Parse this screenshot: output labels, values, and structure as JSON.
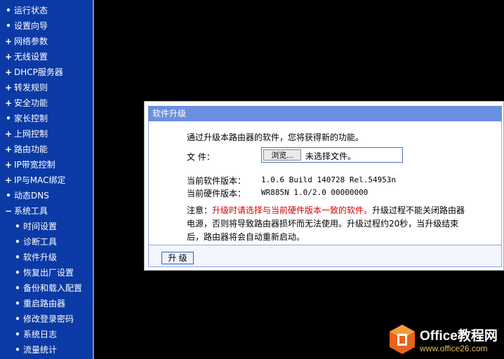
{
  "sidebar": {
    "items": [
      {
        "label": "运行状态",
        "marker": "•",
        "sub": false
      },
      {
        "label": "设置向导",
        "marker": "•",
        "sub": false
      },
      {
        "label": "网络参数",
        "marker": "+",
        "sub": false
      },
      {
        "label": "无线设置",
        "marker": "+",
        "sub": false
      },
      {
        "label": "DHCP服务器",
        "marker": "+",
        "sub": false
      },
      {
        "label": "转发规则",
        "marker": "+",
        "sub": false
      },
      {
        "label": "安全功能",
        "marker": "+",
        "sub": false
      },
      {
        "label": "家长控制",
        "marker": "•",
        "sub": false
      },
      {
        "label": "上网控制",
        "marker": "+",
        "sub": false
      },
      {
        "label": "路由功能",
        "marker": "+",
        "sub": false
      },
      {
        "label": "IP带宽控制",
        "marker": "+",
        "sub": false
      },
      {
        "label": "IP与MAC绑定",
        "marker": "+",
        "sub": false
      },
      {
        "label": "动态DNS",
        "marker": "•",
        "sub": false
      },
      {
        "label": "系统工具",
        "marker": "−",
        "sub": false
      },
      {
        "label": "时间设置",
        "marker": "•",
        "sub": true
      },
      {
        "label": "诊断工具",
        "marker": "•",
        "sub": true
      },
      {
        "label": "软件升级",
        "marker": "•",
        "sub": true
      },
      {
        "label": "恢复出厂设置",
        "marker": "•",
        "sub": true
      },
      {
        "label": "备份和载入配置",
        "marker": "•",
        "sub": true
      },
      {
        "label": "重启路由器",
        "marker": "•",
        "sub": true
      },
      {
        "label": "修改登录密码",
        "marker": "•",
        "sub": true
      },
      {
        "label": "系统日志",
        "marker": "•",
        "sub": true
      },
      {
        "label": "流量统计",
        "marker": "•",
        "sub": true
      }
    ]
  },
  "panel": {
    "title": "软件升级",
    "intro": "通过升级本路由器的软件，您将获得新的功能。",
    "file_label": "文 件：",
    "browse_label": "浏览...",
    "file_status": "未选择文件。",
    "software_version_label": "当前软件版本：",
    "software_version": "1.0.6 Build 140728 Rel.54953n",
    "hardware_version_label": "当前硬件版本：",
    "hardware_version": "WR885N 1.0/2.0 00000000",
    "note_prefix": "注意：",
    "note_warning": "升级时请选择与当前硬件版本一致的软件。",
    "note_rest": "升级过程不能关闭路由器电源，否则将导致路由器损坏而无法使用。升级过程约20秒，当升级结束后，路由器将会自动重新启动。",
    "upgrade_button": "升 级"
  },
  "watermark": {
    "title": "Office教程网",
    "url": "www.office26.com"
  },
  "colors": {
    "sidebar_bg": "#0b3aa6",
    "panel_header": "#6b8fe0",
    "warning": "#d40000"
  }
}
